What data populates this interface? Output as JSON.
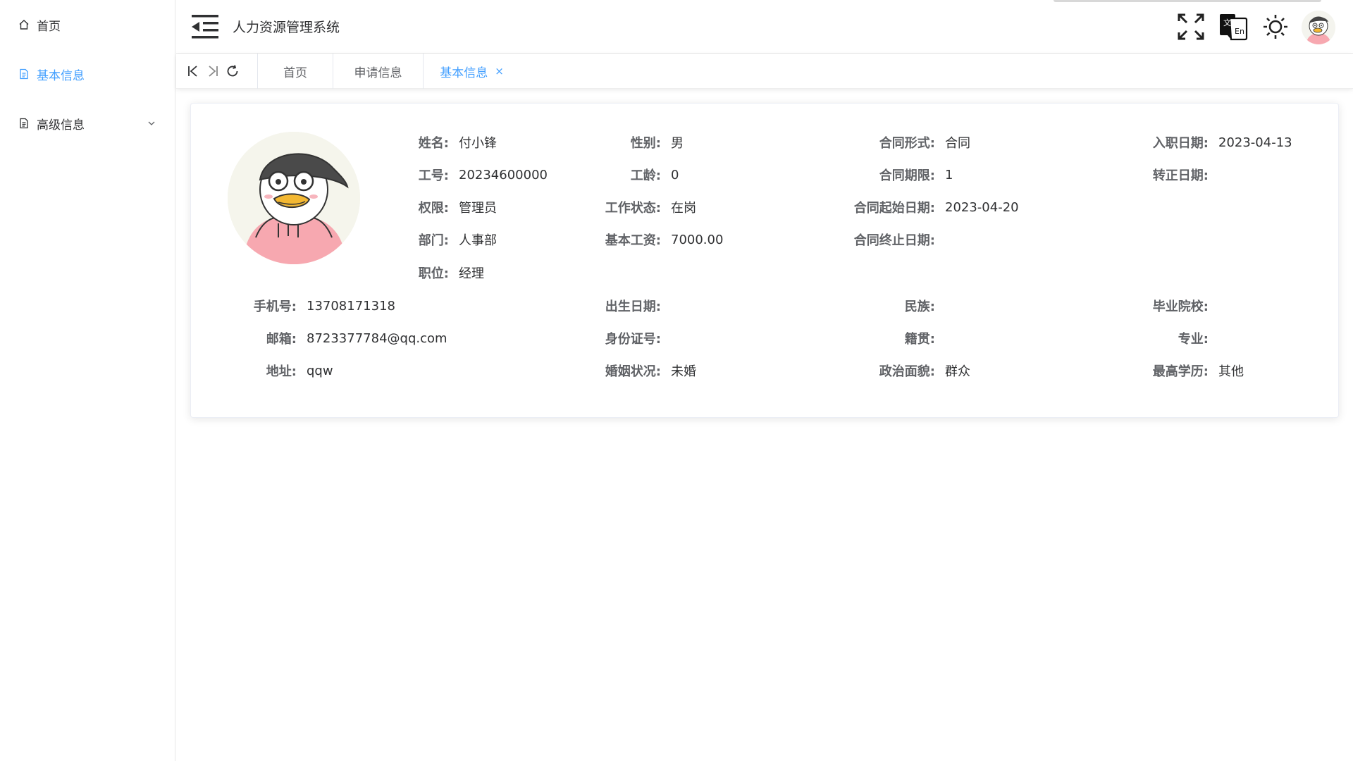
{
  "sidebar": {
    "items": [
      {
        "label": "首页",
        "icon": "home-icon"
      },
      {
        "label": "基本信息",
        "icon": "document-icon",
        "active": true
      },
      {
        "label": "高级信息",
        "icon": "document-icon",
        "expandable": true
      }
    ]
  },
  "header": {
    "title": "人力资源管理系统",
    "icons": [
      "fullscreen-icon",
      "translate-icon",
      "theme-sun-icon",
      "user-avatar"
    ]
  },
  "tabs": {
    "items": [
      {
        "label": "首页"
      },
      {
        "label": "申请信息"
      },
      {
        "label": "基本信息",
        "active": true,
        "closable": true
      }
    ],
    "close_symbol": "×"
  },
  "colors": {
    "accent": "#409eff",
    "text": "#303133",
    "label": "#606266",
    "border": "#ebeef5"
  },
  "profile": {
    "name_label": "姓名:",
    "name": "付小锋",
    "gender_label": "性别:",
    "gender": "男",
    "contract_form_label": "合同形式:",
    "contract_form": "合同",
    "hire_date_label": "入职日期:",
    "hire_date": "2023-04-13",
    "emp_no_label": "工号:",
    "emp_no": "20234600000",
    "seniority_label": "工龄:",
    "seniority": "0",
    "contract_term_label": "合同期限:",
    "contract_term": "1",
    "regular_date_label": "转正日期:",
    "regular_date": "",
    "permission_label": "权限:",
    "permission": "管理员",
    "work_status_label": "工作状态:",
    "work_status": "在岗",
    "contract_start_label": "合同起始日期:",
    "contract_start": "2023-04-20",
    "department_label": "部门:",
    "department": "人事部",
    "base_salary_label": "基本工资:",
    "base_salary": "7000.00",
    "contract_end_label": "合同终止日期:",
    "contract_end": "",
    "position_label": "职位:",
    "position": "经理",
    "phone_label": "手机号:",
    "phone": "13708171318",
    "birth_label": "出生日期:",
    "birth": "",
    "ethnicity_label": "民族:",
    "ethnicity": "",
    "school_label": "毕业院校:",
    "school": "",
    "email_label": "邮箱:",
    "email": "8723377784@qq.com",
    "id_label": "身份证号:",
    "id_no": "",
    "native_label": "籍贯:",
    "native": "",
    "major_label": "专业:",
    "major": "",
    "address_label": "地址:",
    "address": "qqw",
    "marital_label": "婚姻状况:",
    "marital": "未婚",
    "political_label": "政治面貌:",
    "political": "群众",
    "education_label": "最高学历:",
    "education": "其他"
  }
}
